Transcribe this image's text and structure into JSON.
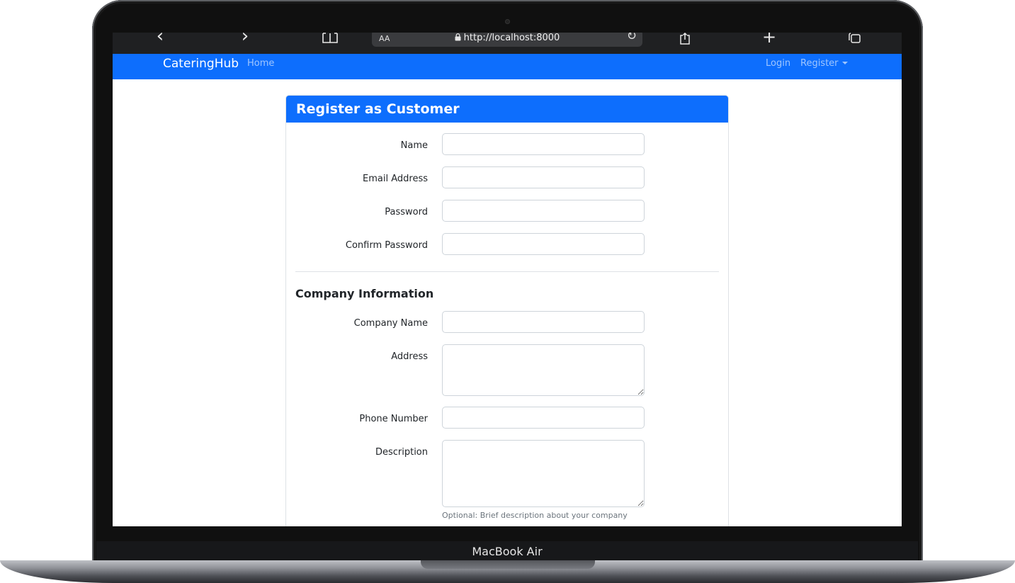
{
  "browser": {
    "url": "http://localhost:8000",
    "aa_label": "AA",
    "back_glyph": "‹",
    "forward_glyph": "›",
    "reload_glyph": "↻",
    "new_tab_glyph": "+",
    "icons": [
      "chevron-left-icon",
      "chevron-right-icon",
      "book-icon",
      "lock-icon",
      "reload-icon",
      "share-icon",
      "plus-icon",
      "tabs-icon"
    ]
  },
  "navbar": {
    "brand": "CateringHub",
    "home": "Home",
    "login": "Login",
    "register": "Register"
  },
  "card": {
    "title": "Register as Customer"
  },
  "account_fields": {
    "name_label": "Name",
    "email_label": "Email Address",
    "password_label": "Password",
    "confirm_password_label": "Confirm Password"
  },
  "company": {
    "section_title": "Company Information",
    "company_name_label": "Company Name",
    "address_label": "Address",
    "phone_label": "Phone Number",
    "description_label": "Description",
    "description_help": "Optional: Brief description about your company"
  },
  "device": {
    "label": "MacBook Air"
  },
  "colors": {
    "primary": "#0d6efd",
    "toolbar": "#1f2022",
    "urlbar": "#3a3b3e"
  }
}
